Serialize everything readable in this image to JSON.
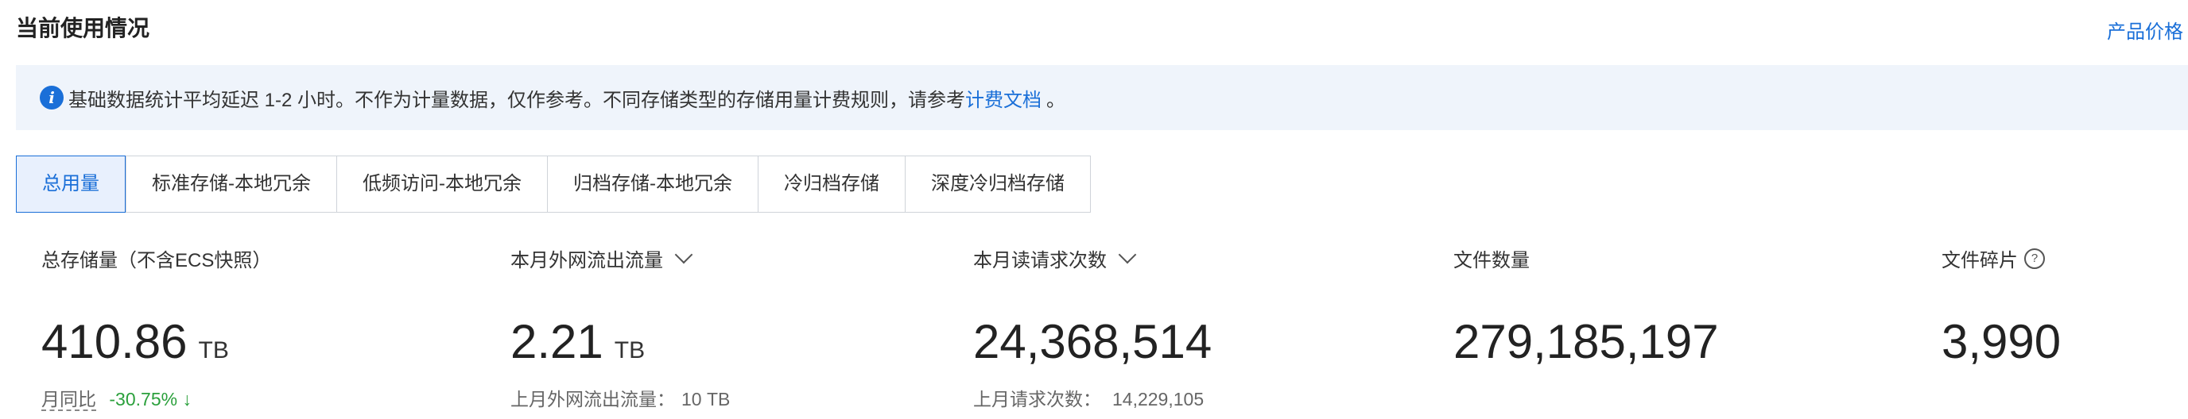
{
  "header": {
    "title": "当前使用情况",
    "link": "产品价格"
  },
  "notice": {
    "icon": "info-icon",
    "text": "基础数据统计平均延迟 1-2 小时。不作为计量数据，仅作参考。不同存储类型的存储用量计费规则，请参考",
    "link": "计费文档",
    "tail": "。"
  },
  "tabs": [
    {
      "label": "总用量"
    },
    {
      "label": "标准存储-本地冗余"
    },
    {
      "label": "低频访问-本地冗余"
    },
    {
      "label": "归档存储-本地冗余"
    },
    {
      "label": "冷归档存储"
    },
    {
      "label": "深度冷归档存储"
    }
  ],
  "metrics": {
    "storage": {
      "label": "总存储量（不含ECS快照）",
      "value": "410.86",
      "unit": "TB",
      "sub_label": "月同比",
      "sub_value": "-30.75%",
      "trend": "↓"
    },
    "traffic": {
      "label": "本月外网流出流量",
      "value": "2.21",
      "unit": "TB",
      "sub_label": "上月外网流出流量：",
      "sub_value": "10 TB"
    },
    "requests": {
      "label": "本月读请求次数",
      "value": "24,368,514",
      "sub_label": "上月请求次数：",
      "sub_value": "14,229,105"
    },
    "files": {
      "label": "文件数量",
      "value": "279,185,197"
    },
    "fragments": {
      "label": "文件碎片",
      "value": "3,990",
      "help": "?"
    }
  },
  "colors": {
    "accent": "#1a6fd8",
    "trend_down": "#2ba03c",
    "notice_bg": "#eff4fb"
  }
}
